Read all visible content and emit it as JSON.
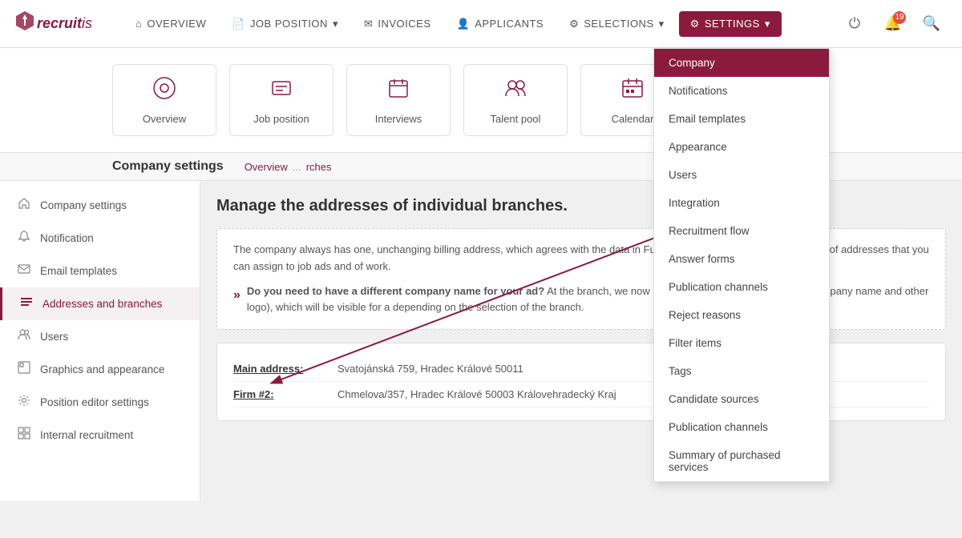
{
  "logo": {
    "icon": "🔱",
    "text_part1": "recruit",
    "text_part2": "is"
  },
  "nav": {
    "items": [
      {
        "label": "OVERVIEW",
        "icon": "⌂",
        "active": false
      },
      {
        "label": "JOB POSITION",
        "icon": "📄",
        "active": false,
        "has_caret": true
      },
      {
        "label": "INVOICES",
        "icon": "✉",
        "active": false
      },
      {
        "label": "APPLICANTS",
        "icon": "👤",
        "active": false
      },
      {
        "label": "SELECTIONS",
        "icon": "⚙",
        "active": false,
        "has_caret": true
      },
      {
        "label": "SETTINGS",
        "icon": "⚙",
        "active": true,
        "has_caret": true
      }
    ],
    "notification_count": "19"
  },
  "tiles": [
    {
      "label": "Overview",
      "icon": "⊙"
    },
    {
      "label": "Job position",
      "icon": "☰"
    },
    {
      "label": "Interviews",
      "icon": "📅"
    },
    {
      "label": "Talent pool",
      "icon": "👥"
    },
    {
      "label": "Calendar",
      "icon": "📆"
    }
  ],
  "breadcrumb": {
    "items": [
      "Overview",
      "rches"
    ],
    "separator": "..."
  },
  "page_title": "Company settings",
  "sidebar": {
    "items": [
      {
        "label": "Company settings",
        "icon": "🏠",
        "active": false
      },
      {
        "label": "Notification",
        "icon": "🔔",
        "active": false
      },
      {
        "label": "Email templates",
        "icon": "✉",
        "active": false
      },
      {
        "label": "Addresses and branches",
        "icon": "☰",
        "active": true
      },
      {
        "label": "Users",
        "icon": "👥",
        "active": false
      },
      {
        "label": "Graphics and appearance",
        "icon": "🖼",
        "active": false
      },
      {
        "label": "Position editor settings",
        "icon": "⚙",
        "active": false
      },
      {
        "label": "Internal recruitment",
        "icon": "🔲",
        "active": false
      }
    ]
  },
  "content": {
    "section_title": "Manage the addresses of individual branches.",
    "info_text": "The company always has one, unchanging billing address, which agrees with the data in Furthermore, you can have any number of addresses that you can assign to job ads and of work.",
    "highlight_text": "Do you need to have a different company name for your ad?",
    "highlight_detail": "At the branch, we now a company data (company name, company name and other logo), which will be visible for a depending on the selection of the branch.",
    "main_address_label": "Main address:",
    "main_address_value": "Svatojánská 759, Hradec Králové 50011",
    "firm_label": "Firm #2:",
    "firm_value": "Chmelova/357, Hradec Králové 50003 Královehradecký Kraj"
  },
  "dropdown": {
    "items": [
      {
        "label": "Company",
        "active": true
      },
      {
        "label": "Notifications",
        "active": false
      },
      {
        "label": "Email templates",
        "active": false
      },
      {
        "label": "Appearance",
        "active": false
      },
      {
        "label": "Users",
        "active": false
      },
      {
        "label": "Integration",
        "active": false
      },
      {
        "label": "Recruitment flow",
        "active": false
      },
      {
        "label": "Answer forms",
        "active": false
      },
      {
        "label": "Publication channels",
        "active": false
      },
      {
        "label": "Reject reasons",
        "active": false
      },
      {
        "label": "Filter items",
        "active": false
      },
      {
        "label": "Tags",
        "active": false
      },
      {
        "label": "Candidate sources",
        "active": false
      },
      {
        "label": "Publication channels",
        "active": false
      },
      {
        "label": "Summary of purchased services",
        "active": false
      }
    ]
  }
}
